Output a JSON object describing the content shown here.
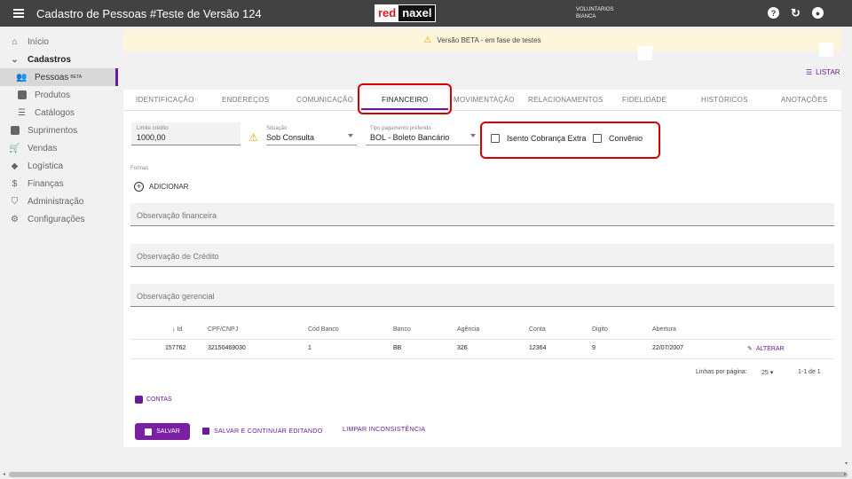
{
  "appbar": {
    "title": "Cadastro de Pessoas #Teste de Versão 124",
    "logo_left": "red",
    "logo_right": "naxel",
    "user_line1": "VOLUNTARIOS",
    "user_line2": "BIANCA",
    "help_icon": "help-icon",
    "refresh_icon": "refresh-icon",
    "account_icon": "account-icon"
  },
  "sidebar": {
    "items": [
      {
        "label": "Início",
        "icon": "home-icon"
      },
      {
        "label": "Cadastros",
        "icon": "chevron-down-icon"
      },
      {
        "label": "Pessoas",
        "badge": "BETA",
        "icon": "people-icon"
      },
      {
        "label": "Produtos",
        "icon": "book-icon"
      },
      {
        "label": "Catálogos",
        "icon": "list-icon"
      },
      {
        "label": "Suprimentos",
        "icon": "box-icon"
      },
      {
        "label": "Vendas",
        "icon": "cart-icon"
      },
      {
        "label": "Logística",
        "icon": "route-icon"
      },
      {
        "label": "Finanças",
        "icon": "money-icon"
      },
      {
        "label": "Administração",
        "icon": "shield-icon"
      },
      {
        "label": "Configurações",
        "icon": "gear-icon"
      }
    ]
  },
  "banner": {
    "text": "Versão BETA - em fase de testes"
  },
  "listar": "LISTAR",
  "tabs": [
    "IDENTIFICAÇÃO",
    "ENDEREÇOS",
    "COMUNICAÇÃO",
    "FINANCEIRO",
    "MOVIMENTAÇÃO",
    "RELACIONAMENTOS",
    "FIDELIDADE",
    "HISTÓRICOS",
    "ANOTAÇÕES"
  ],
  "active_tab": "FINANCEIRO",
  "form": {
    "limite_label": "Limite crédito",
    "limite_value": "1000,00",
    "situacao_label": "Situação",
    "situacao_value": "Sob Consulta",
    "tipo_label": "Tipo pagamento preferido",
    "tipo_value": "BOL - Boleto Bancário",
    "isento_label": "Isento Cobrança Extra",
    "convenio_label": "Convênio",
    "formas_label": "Formas",
    "adicionar": "ADICIONAR",
    "obs_financeira": "Observação financeira",
    "obs_credito": "Observação de Crédito",
    "obs_gerencial": "Observação gerencial"
  },
  "table": {
    "headers": [
      "Id",
      "CPF/CNPJ",
      "Cód Banco",
      "Banco",
      "Agência",
      "Conta",
      "Digito",
      "Abertura"
    ],
    "rows": [
      [
        "157762",
        "32150469030",
        "1",
        "BB",
        "326",
        "12364",
        "9",
        "22/07/2007"
      ]
    ],
    "action": "ALTERAR",
    "rows_per_page_label": "Linhas por página:",
    "rows_per_page": "25",
    "range": "1-1 de 1"
  },
  "contas": "CONTAS",
  "actions": {
    "salvar": "SALVAR",
    "salvar_continuar": "SALVAR E CONTINUAR EDITANDO",
    "limpar": "LIMPAR INCONSISTÊNCIA"
  },
  "colors": {
    "accent": "#6a1b9a",
    "highlight": "#d70000",
    "appbar": "#424242"
  }
}
